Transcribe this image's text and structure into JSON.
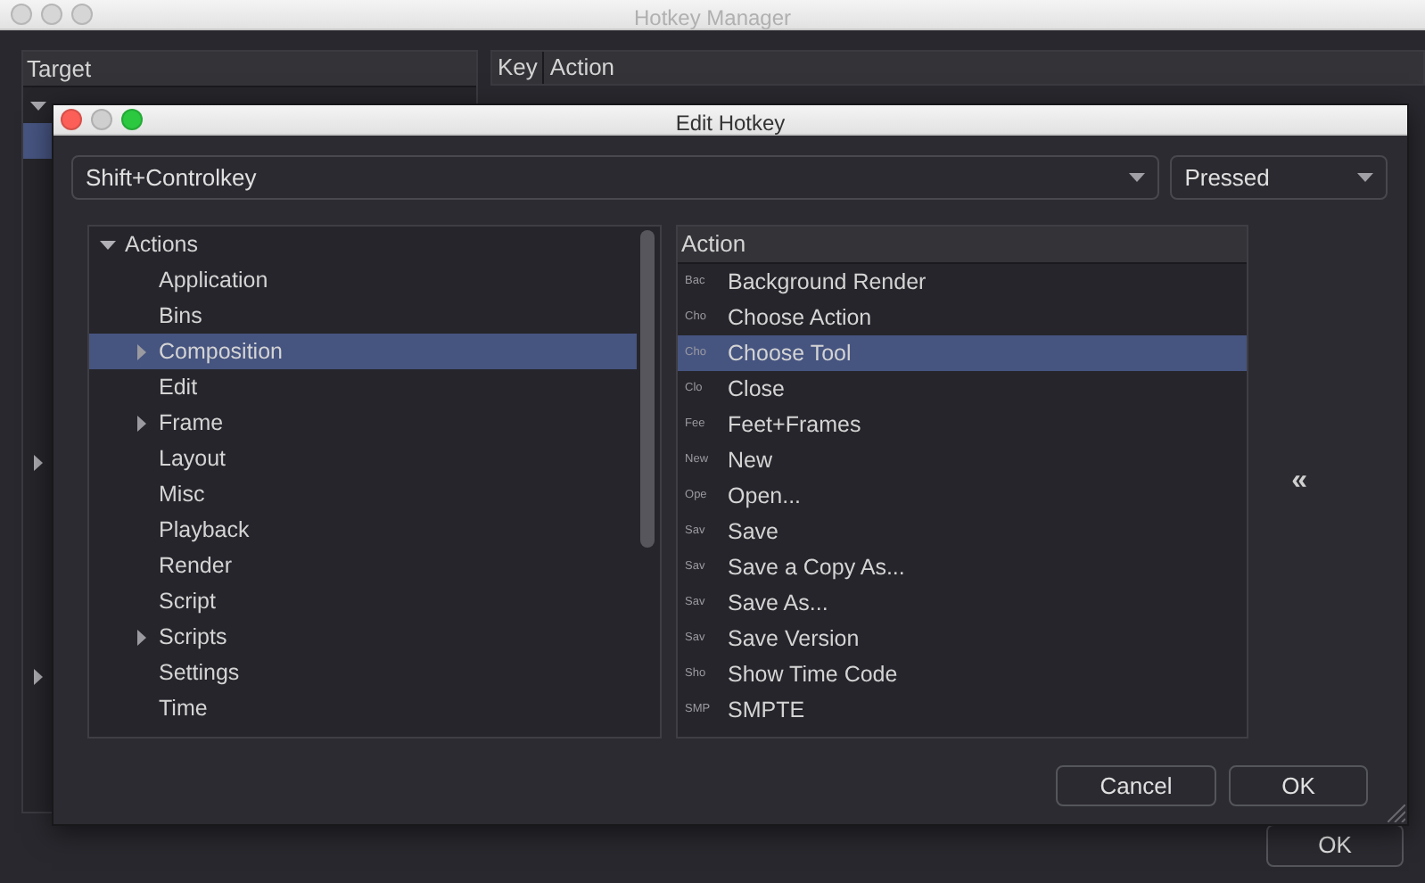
{
  "main_window": {
    "title": "Hotkey Manager",
    "target_header": "Target",
    "key_header": "Key",
    "action_header": "Action",
    "target_rows": [
      {
        "expanded": true,
        "selected": false
      },
      {
        "selected": true
      },
      {
        "selected": false
      },
      {
        "selected": false
      },
      {
        "selected": false
      },
      {
        "selected": false
      },
      {
        "selected": false
      },
      {
        "selected": false
      },
      {
        "selected": false
      },
      {
        "selected": false
      },
      {
        "selected": false,
        "expanded": false
      },
      {
        "selected": false
      },
      {
        "selected": false
      },
      {
        "selected": false
      },
      {
        "selected": false
      },
      {
        "selected": false
      },
      {
        "selected": false,
        "expanded": false
      }
    ],
    "ok_button": "OK"
  },
  "dialog": {
    "title": "Edit Hotkey",
    "key_combo": "Shift+Controlkey",
    "event_combo": "Pressed",
    "tree": [
      {
        "label": "Actions",
        "expanded": true,
        "selected": false,
        "children": [
          {
            "label": "Application",
            "selected": false
          },
          {
            "label": "Bins",
            "selected": false
          },
          {
            "label": "Composition",
            "selected": true,
            "expanded": false
          },
          {
            "label": "Edit",
            "selected": false
          },
          {
            "label": "Frame",
            "selected": false,
            "expanded": false
          },
          {
            "label": "Layout",
            "selected": false
          },
          {
            "label": "Misc",
            "selected": false
          },
          {
            "label": "Playback",
            "selected": false
          },
          {
            "label": "Render",
            "selected": false
          },
          {
            "label": "Script",
            "selected": false
          },
          {
            "label": "Scripts",
            "selected": false,
            "expanded": false
          },
          {
            "label": "Settings",
            "selected": false
          },
          {
            "label": "Time",
            "selected": false
          }
        ]
      }
    ],
    "action_header": "Action",
    "actions": [
      {
        "abbr": "Bac",
        "label": "Background Render",
        "selected": false
      },
      {
        "abbr": "Cho",
        "label": "Choose Action",
        "selected": false
      },
      {
        "abbr": "Cho",
        "label": "Choose Tool",
        "selected": true
      },
      {
        "abbr": "Clo",
        "label": "Close",
        "selected": false
      },
      {
        "abbr": "Fee",
        "label": "Feet+Frames",
        "selected": false
      },
      {
        "abbr": "New",
        "label": "New",
        "selected": false
      },
      {
        "abbr": "Ope",
        "label": "Open...",
        "selected": false
      },
      {
        "abbr": "Sav",
        "label": "Save",
        "selected": false
      },
      {
        "abbr": "Sav",
        "label": "Save a Copy As...",
        "selected": false
      },
      {
        "abbr": "Sav",
        "label": "Save As...",
        "selected": false
      },
      {
        "abbr": "Sav",
        "label": "Save Version",
        "selected": false
      },
      {
        "abbr": "Sho",
        "label": "Show Time Code",
        "selected": false
      },
      {
        "abbr": "SMP",
        "label": "SMPTE",
        "selected": false
      }
    ],
    "assign_button": "«",
    "buttons": [
      "Cancel",
      "OK"
    ]
  }
}
